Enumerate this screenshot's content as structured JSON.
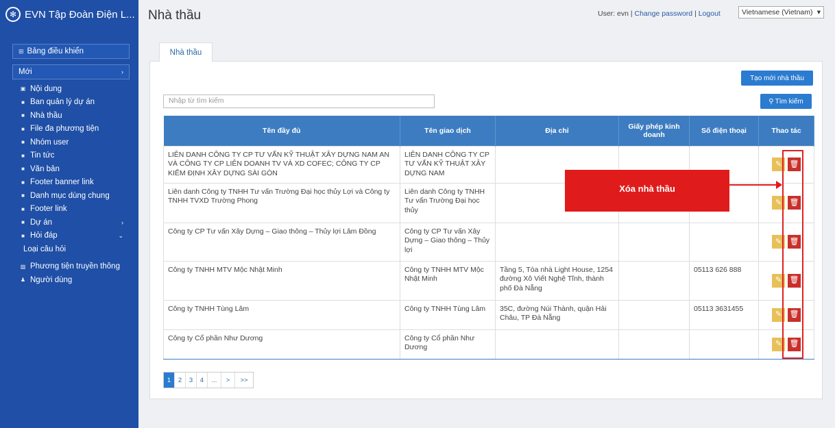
{
  "sidebar": {
    "brand": "EVN Tập Đoàn Điện L...",
    "dashboard": "Bảng điều khiển",
    "new_menu": "Mới",
    "items": [
      {
        "label": "Nội dung",
        "icon": "document-icon"
      },
      {
        "label": "Ban quản lý dự án",
        "icon": "square-icon"
      },
      {
        "label": "Nhà thầu",
        "icon": "square-icon"
      },
      {
        "label": "File đa phương tiện",
        "icon": "square-icon"
      },
      {
        "label": "Nhóm user",
        "icon": "square-icon"
      },
      {
        "label": "Tin tức",
        "icon": "square-icon"
      },
      {
        "label": "Văn bản",
        "icon": "square-icon"
      },
      {
        "label": "Footer banner link",
        "icon": "square-icon"
      },
      {
        "label": "Danh mục dùng chung",
        "icon": "square-icon"
      },
      {
        "label": "Footer link",
        "icon": "square-icon"
      },
      {
        "label": "Dự án",
        "icon": "square-icon"
      },
      {
        "label": "Hỏi đáp",
        "icon": "square-icon"
      },
      {
        "label": "Loại câu hỏi"
      },
      {
        "label": "Phương tiện truyền thông",
        "icon": "image-icon"
      },
      {
        "label": "Người dùng",
        "icon": "user-icon"
      }
    ]
  },
  "header": {
    "title": "Nhà thầu",
    "user_prefix": "User: evn |",
    "change_password": "Change password",
    "separator": "|",
    "logout": "Logout",
    "language": "Vietnamese (Vietnam)"
  },
  "tab": "Nhà thầu",
  "toolbar": {
    "create_label": "Tạo mới nhà thầu",
    "search_placeholder": "Nhập từ tìm kiếm",
    "search_label": "Tìm kiếm"
  },
  "table": {
    "headers": [
      "Tên đầy đủ",
      "Tên giao dịch",
      "Địa chỉ",
      "Giấy phép kinh doanh",
      "Số điện thoại",
      "Thao tác"
    ],
    "rows": [
      {
        "full_name": "LIÊN DANH CÔNG TY CP TƯ VẤN KỸ THUẬT XÂY DỰNG NAM AN VÀ CÔNG TY CP LIÊN DOANH TV VÀ XD COFEC; CÔNG TY CP KIỂM ĐỊNH XÂY DỰNG SÀI GÒN",
        "trade_name": "LIÊN DANH CÔNG TY CP TƯ VẤN KỸ THUẬT XÂY DỰNG NAM",
        "address": "",
        "license": "",
        "phone": ""
      },
      {
        "full_name": "Liên danh Công ty TNHH Tư vấn Trường Đại học thủy Lợi và Công ty TNHH TVXD Trường Phong",
        "trade_name": "Liên danh Công ty TNHH Tư vấn Trường Đại học thủy",
        "address": "",
        "license": "",
        "phone": ""
      },
      {
        "full_name": "Công ty CP Tư vấn Xây Dựng – Giao thông – Thủy lợi Lâm Đồng",
        "trade_name": "Công ty CP Tư vấn Xây Dựng – Giao thông – Thủy lợi",
        "address": "",
        "license": "",
        "phone": ""
      },
      {
        "full_name": "Công ty TNHH MTV Mộc Nhật Minh",
        "trade_name": "Công ty TNHH MTV Mộc Nhật Minh",
        "address": "Tầng 5, Tòa nhà Light House, 1254 đường Xô Viết Nghệ Tĩnh, thành phố Đà Nẵng",
        "license": "",
        "phone": "05113 626 888"
      },
      {
        "full_name": "Công ty TNHH Tùng Lâm",
        "trade_name": "Công ty TNHH Tùng Lâm",
        "address": "35C, đường Núi Thành, quận Hải Châu, TP Đà Nẵng",
        "license": "",
        "phone": "05113 3631455"
      },
      {
        "full_name": "Công ty Cổ phần Như Dương",
        "trade_name": "Công ty Cổ phần Như Dương",
        "address": "",
        "license": "",
        "phone": ""
      }
    ]
  },
  "annotation": {
    "label": "Xóa nhà thầu"
  },
  "pagination": [
    "1",
    "2",
    "3",
    "4",
    "...",
    ">",
    ">>"
  ],
  "colors": {
    "sidebar": "#1f4fa6",
    "primary": "#2b7bd0",
    "table_header": "#3d7cc0",
    "edit": "#e8c05a",
    "delete": "#c9302c",
    "annotation": "#e01b1b"
  }
}
